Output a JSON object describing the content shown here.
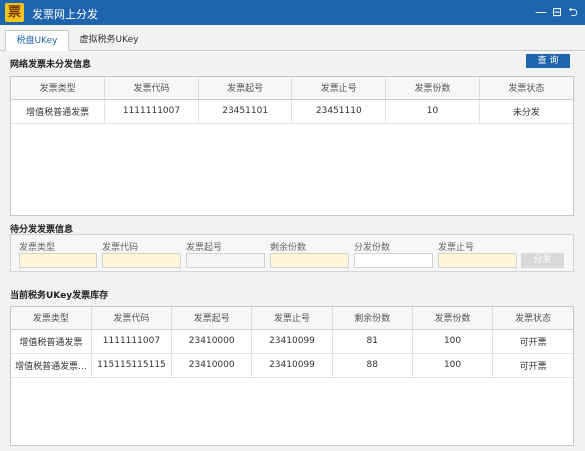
{
  "window": {
    "title": "发票网上分发",
    "app_icon_glyph": "票",
    "minimize_glyph": "—",
    "restore_glyph": "⊟",
    "back_glyph": "⮌"
  },
  "tabs": [
    {
      "label": "税盘UKey"
    },
    {
      "label": "虚拟税务UKey"
    }
  ],
  "network_section": {
    "title": "网络发票未分发信息",
    "query_label": "查 询",
    "columns": [
      "发票类型",
      "发票代码",
      "发票起号",
      "发票止号",
      "发票份数",
      "发票状态"
    ],
    "rows": [
      [
        "增值税普通发票",
        "1111111007",
        "23451101",
        "23451110",
        "10",
        "未分发"
      ]
    ]
  },
  "pending_section": {
    "title": "待分发发票信息",
    "fields": [
      {
        "label": "发票类型"
      },
      {
        "label": "发票代码"
      },
      {
        "label": "发票起号"
      },
      {
        "label": "剩余份数"
      },
      {
        "label": "分发份数"
      },
      {
        "label": "发票止号"
      }
    ],
    "distribute_label": "分发"
  },
  "inventory_section": {
    "title": "当前税务UKey发票库存",
    "columns": [
      "发票类型",
      "发票代码",
      "发票起号",
      "发票止号",
      "剩余份数",
      "发票份数",
      "发票状态"
    ],
    "rows": [
      [
        "增值税普通发票",
        "1111111007",
        "23410000",
        "23410099",
        "81",
        "100",
        "可开票"
      ],
      [
        "增值税普通发票...",
        "115115115115",
        "23410000",
        "23410099",
        "88",
        "100",
        "可开票"
      ]
    ]
  },
  "colors": {
    "titlebar": "#1e64ad",
    "accent": "#1e64ad",
    "input_highlight": "#fff7d8"
  }
}
